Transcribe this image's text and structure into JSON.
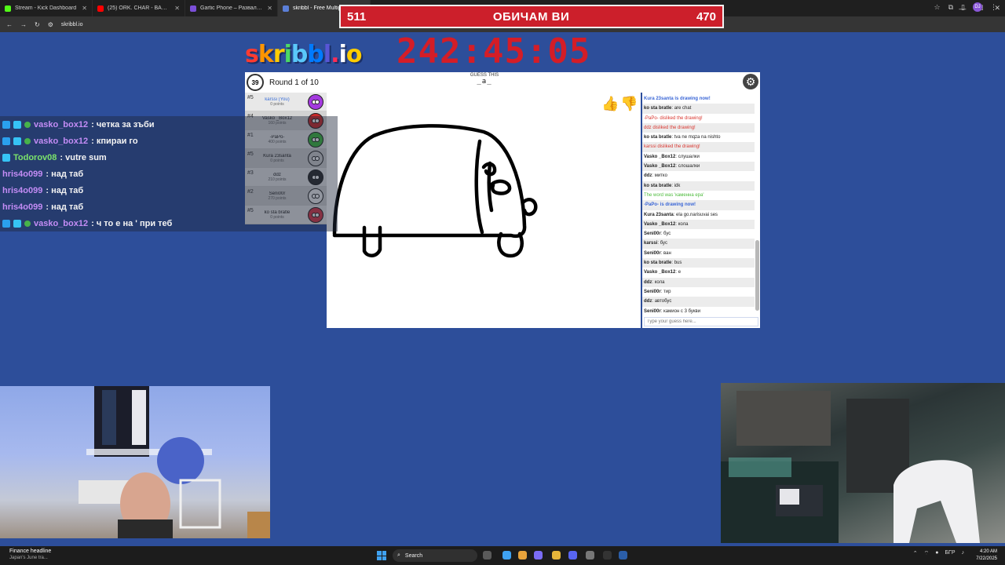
{
  "browser": {
    "tabs": [
      {
        "title": "Stream - Kick Dashboard",
        "color": "#53fc18",
        "active": false
      },
      {
        "title": "(25) ORK. CHAR - BAM BAM / ОРК. ЧАР",
        "color": "#ff0000",
        "active": false
      },
      {
        "title": "Gartic Phone – Развален телефон",
        "color": "#7b4fd8",
        "active": false
      },
      {
        "title": "skribbl - Free Multiplayer Drawing",
        "color": "#5b7fd8",
        "active": true
      }
    ],
    "url": "skribbl.io",
    "profile_initials": "DJ"
  },
  "overlay": {
    "score_left": "511",
    "message": "ОБИЧАМ ВИ",
    "score_right": "470",
    "timer": "242:45:05"
  },
  "game": {
    "logo": "skribbl.io",
    "logo_colors": [
      "#ff3b30",
      "#ff9500",
      "#ffcc00",
      "#4cd964",
      "#5ac8fa",
      "#007aff",
      "#5856d6",
      "#ff2d55",
      "#ffffff",
      "#ffcc00"
    ],
    "timer_seconds": "39",
    "round_label": "Round 1 of 10",
    "guess_label": "GUESS THIS",
    "word_hint": "_a_",
    "letter_count": "3",
    "players": [
      {
        "rank": "#5",
        "name": "karssi (You)",
        "points": "0 points",
        "you": true,
        "avatar": "#a43adf"
      },
      {
        "rank": "#4",
        "name": "Vasko _Box12",
        "points": "160 points",
        "you": false,
        "avatar": "#c92a2a"
      },
      {
        "rank": "#1",
        "name": "-PaPo-",
        "points": "400 points",
        "you": false,
        "avatar": "#3fba3f"
      },
      {
        "rank": "#5",
        "name": "Kura 23santa",
        "points": "0 points",
        "you": false,
        "avatar": "#cfcfcf"
      },
      {
        "rank": "#3",
        "name": "ddz",
        "points": "210 points",
        "you": false,
        "avatar": "#2a2a2a"
      },
      {
        "rank": "#2",
        "name": "Seni00r",
        "points": "270 points",
        "you": false,
        "avatar": "#f0f0f0"
      },
      {
        "rank": "#5",
        "name": "ko sta bratle",
        "points": "0 points",
        "you": false,
        "avatar": "#d93a4a"
      }
    ],
    "chat": [
      {
        "text": "Kura 23santa is drawing now!",
        "type": "sys-blue"
      },
      {
        "author": "ko sta bratle",
        "text": "are chat",
        "type": "msg"
      },
      {
        "text": "-PaPo- disliked the drawing!",
        "type": "sys-red"
      },
      {
        "text": "ddz disliked the drawing!",
        "type": "sys-red"
      },
      {
        "author": "ko sta bratle",
        "text": "tva ne mqza na nishto",
        "type": "msg"
      },
      {
        "text": "karssi disliked the drawing!",
        "type": "sys-red"
      },
      {
        "author": "Vasko _Box12",
        "text": "слушалки",
        "type": "msg"
      },
      {
        "author": "Vasko _Box12",
        "text": "слошалки",
        "type": "msg"
      },
      {
        "author": "ddz",
        "text": "митко",
        "type": "msg"
      },
      {
        "author": "ko sta bratle",
        "text": "idk",
        "type": "msg"
      },
      {
        "text": "The word was 'каменна ера'",
        "type": "sys-green"
      },
      {
        "text": "-PaPo- is drawing now!",
        "type": "sys-blue"
      },
      {
        "author": "Kura 23santa",
        "text": "ela go.narisuvai ses",
        "type": "msg"
      },
      {
        "author": "Vasko _Box12",
        "text": "кола",
        "type": "msg"
      },
      {
        "author": "Seni00r",
        "text": "бус",
        "type": "msg"
      },
      {
        "author": "karssi",
        "text": "бус",
        "type": "msg"
      },
      {
        "author": "Seni00r",
        "text": "ван",
        "type": "msg"
      },
      {
        "author": "ko sta bratle",
        "text": "bus",
        "type": "msg"
      },
      {
        "author": "Vasko _Box12",
        "text": "е",
        "type": "msg"
      },
      {
        "author": "ddz",
        "text": "кола",
        "type": "msg"
      },
      {
        "author": "Seni00r",
        "text": "тир",
        "type": "msg"
      },
      {
        "author": "ddz",
        "text": "автобус",
        "type": "msg"
      },
      {
        "author": "Seni00r",
        "text": "камион с 3 букви",
        "type": "msg"
      }
    ],
    "chat_placeholder": "Type your guess here..."
  },
  "stream_chat": [
    {
      "user": "vasko_box12",
      "message": ": четка за зъби",
      "color": "#c38cf5",
      "badges": [
        "b1",
        "b2",
        "b3"
      ]
    },
    {
      "user": "vasko_box12",
      "message": ": кпирaи го",
      "color": "#c38cf5",
      "badges": [
        "b1",
        "b2",
        "b3"
      ]
    },
    {
      "user": "Todorov08",
      "message": ": vutre sum",
      "color": "#7be36b",
      "badges": [
        "b2"
      ]
    },
    {
      "user": "hris4o099",
      "message": ": над таб",
      "color": "#c38cf5",
      "badges": []
    },
    {
      "user": "hris4o099",
      "message": ": над таб",
      "color": "#c38cf5",
      "badges": []
    },
    {
      "user": "hris4o099",
      "message": ": над таб",
      "color": "#c38cf5",
      "badges": []
    },
    {
      "user": "vasko_box12",
      "message": ": ч то е на ' при теб",
      "color": "#c38cf5",
      "badges": [
        "b1",
        "b2",
        "b3"
      ]
    }
  ],
  "taskbar": {
    "news_title": "Finance headline",
    "news_sub": "Japan's June tra...",
    "search_label": "Search",
    "tray_lang": "БГР",
    "time": "4:20 AM",
    "date": "7/22/2025"
  }
}
